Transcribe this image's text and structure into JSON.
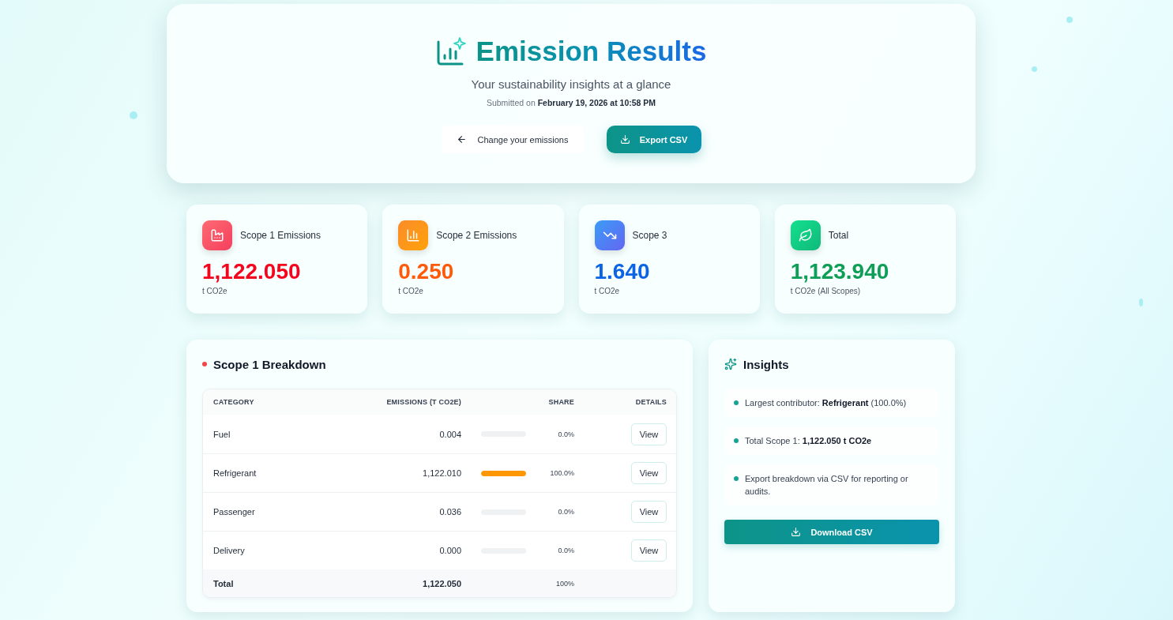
{
  "header": {
    "title": "Emission Results",
    "subtitle": "Your sustainability insights at a glance",
    "submitted": "Submitted on **February 19, 2026 at 10:58 PM**",
    "buttons": [
      {
        "kind": "back",
        "label": "Change your emissions"
      },
      {
        "kind": "export",
        "label": "Export CSV"
      }
    ]
  },
  "stats": [
    {
      "kind": "factory",
      "label": "Scope 1 Emissions",
      "value": "1,122.050",
      "unit": "t CO2e",
      "color": "#f5051d"
    },
    {
      "kind": "bars",
      "label": "Scope 2 Emissions",
      "value": "0.250",
      "unit": "t CO2e",
      "color": "#ff5a0a"
    },
    {
      "kind": "trend",
      "label": "Scope 3",
      "value": "1.640",
      "unit": "t CO2e",
      "color": "#0b63e5"
    },
    {
      "kind": "leaf",
      "label": "Total",
      "value": "1,123.940",
      "unit": "t CO2e (All Scopes)",
      "color": "#0f9e56"
    }
  ],
  "breakdown": {
    "title": "Scope 1 Breakdown",
    "columns": [
      "CATEGORY",
      "EMISSIONS (T CO2E)",
      "SHARE",
      "DETAILS"
    ],
    "rows": [
      {
        "category": "Fuel",
        "emissions": "0.004",
        "level": 0,
        "share": "0.0%",
        "action": "View"
      },
      {
        "category": "Refrigerant",
        "emissions": "1,122.010",
        "level": 1,
        "share": "100.0%",
        "action": "View"
      },
      {
        "category": "Passenger",
        "emissions": "0.036",
        "level": 0,
        "share": "0.0%",
        "action": "View"
      },
      {
        "category": "Delivery",
        "emissions": "0.000",
        "level": 0,
        "share": "0.0%",
        "action": "View"
      }
    ],
    "total": {
      "category": "Total",
      "emissions": "1,122.050",
      "share": "100%"
    }
  },
  "insights": {
    "title": "Insights",
    "items": [
      "Largest contributor: **Refrigerant** (100.0%)",
      "Total Scope 1: **1,122.050 t CO2e**",
      "Export breakdown via CSV for reporting or audits."
    ],
    "button": "Download CSV"
  }
}
